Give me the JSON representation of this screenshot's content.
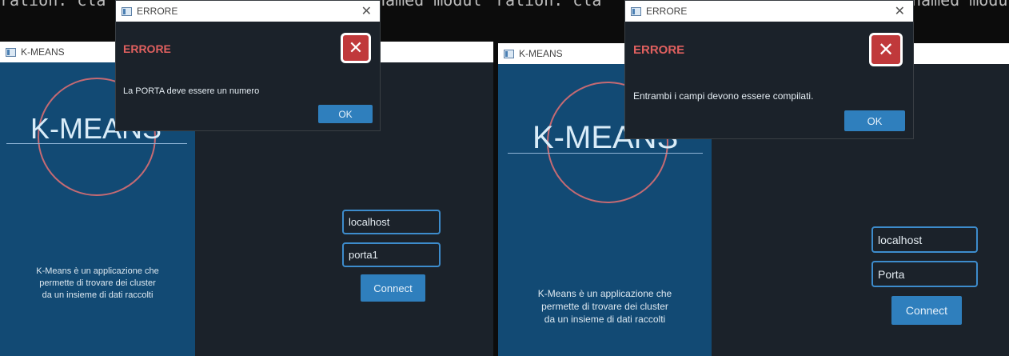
{
  "console": {
    "fragment_1": "ration: cla",
    "fragment_2": "named modul",
    "fragment_3": "ration: cla",
    "fragment_4": "named modu"
  },
  "left_app": {
    "title": "K-MEANS",
    "logo": "K-MEANS",
    "description": [
      "K-Means è un applicazione che",
      "permette di trovare dei cluster",
      "da un insieme di dati raccolti"
    ],
    "host_value": "localhost",
    "port_value": "porta1",
    "connect_label": "Connect"
  },
  "left_dialog": {
    "window_title": "ERRORE",
    "heading": "ERRORE",
    "message": "La PORTA deve essere un numero",
    "ok_label": "OK"
  },
  "right_app": {
    "title": "K-MEANS",
    "logo": "K-MEANS",
    "description": [
      "K-Means è un applicazione che",
      "permette di trovare dei cluster",
      "da un insieme di dati raccolti"
    ],
    "host_value": "localhost",
    "port_value": "Porta",
    "connect_label": "Connect"
  },
  "right_dialog": {
    "window_title": "ERRORE",
    "heading": "ERRORE",
    "message": "Entrambi i campi devono essere compilati.",
    "ok_label": "OK"
  },
  "icons": {
    "app": "window-app-icon",
    "close": "close-icon",
    "error": "error-x-icon"
  },
  "colors": {
    "panel_blue": "#124a74",
    "dark_bg": "#1b222a",
    "accent": "#2f7fbd",
    "error_red": "#c0393b",
    "heading_red": "#e0605f"
  }
}
